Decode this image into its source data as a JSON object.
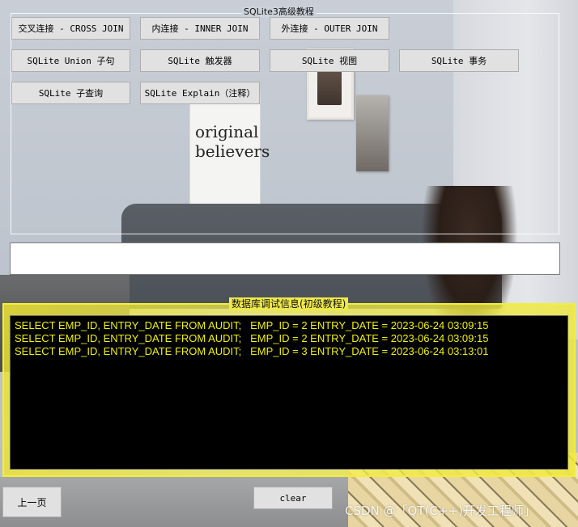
{
  "advanced_group": {
    "title": "SQLite3高级教程",
    "buttons": {
      "cross_join": "交叉连接 - CROSS JOIN",
      "inner_join": "内连接 - INNER JOIN",
      "outer_join": "外连接 - OUTER JOIN",
      "union": "SQLite Union 子句",
      "trigger": "SQLite 触发器",
      "view": "SQLite 视图",
      "transaction": "SQLite 事务",
      "subquery": "SQLite 子查询",
      "explain": "SQLite Explain（注释）"
    }
  },
  "sql_input": {
    "value": ""
  },
  "debug_group": {
    "title": "数据库调试信息(初级教程)",
    "log_lines": [
      "SELECT EMP_ID, ENTRY_DATE FROM AUDIT;   EMP_ID = 2 ENTRY_DATE = 2023-06-24 03:09:15",
      "SELECT EMP_ID, ENTRY_DATE FROM AUDIT;   EMP_ID = 2 ENTRY_DATE = 2023-06-24 03:09:15",
      "SELECT EMP_ID, ENTRY_DATE FROM AUDIT;   EMP_ID = 3 ENTRY_DATE = 2023-06-24 03:13:01"
    ]
  },
  "bottom": {
    "prev_page": "上一页",
    "clear": "clear"
  },
  "background_text": {
    "bag_text": "original believers"
  },
  "watermark": "CSDN @「QT(C++)开发工程师」",
  "colors": {
    "log_text": "#f2f200",
    "log_background": "#000000",
    "debug_group_fill": "#efe94a",
    "button_face": "#e1e1e1"
  }
}
